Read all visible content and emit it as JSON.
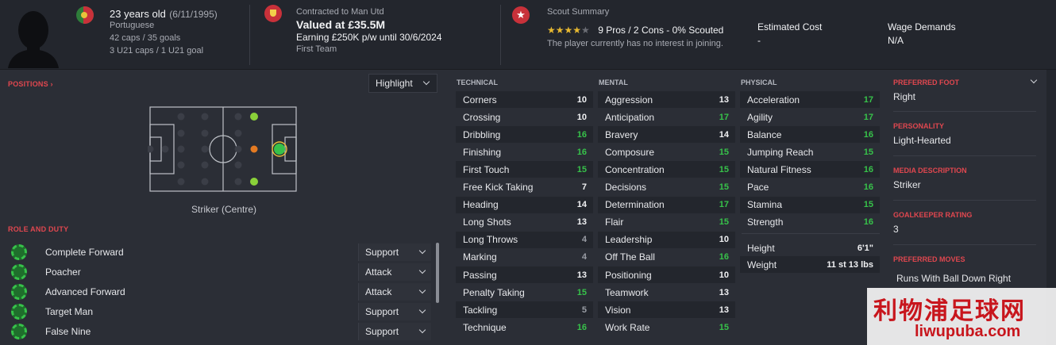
{
  "header": {
    "age": "23 years old",
    "dob": "(6/11/1995)",
    "nationality": "Portuguese",
    "caps": "42 caps / 35 goals",
    "u21_caps": "3 U21 caps / 1 U21 goal",
    "contract_label": "Contracted to Man Utd",
    "value": "Valued at £35.5M",
    "earning": "Earning £250K p/w until 30/6/2024",
    "squad": "First Team",
    "scout_title": "Scout Summary",
    "scout_stars": "★★★★",
    "scout_half": "★",
    "scout_summary": "9 Pros / 2 Cons - 0% Scouted",
    "interest": "The player currently has no interest in joining.",
    "est_cost_label": "Estimated Cost",
    "est_cost_value": "-",
    "wage_label": "Wage Demands",
    "wage_value": "N/A"
  },
  "positions": {
    "label": "POSITIONS",
    "arrow": "›",
    "highlight": "Highlight",
    "position_name": "Striker (Centre)"
  },
  "roles": {
    "label": "ROLE AND DUTY",
    "items": [
      {
        "name": "Complete Forward",
        "duty": "Support"
      },
      {
        "name": "Poacher",
        "duty": "Attack"
      },
      {
        "name": "Advanced Forward",
        "duty": "Attack"
      },
      {
        "name": "Target Man",
        "duty": "Support"
      },
      {
        "name": "False Nine",
        "duty": "Support"
      }
    ]
  },
  "technical": {
    "label": "TECHNICAL",
    "items": [
      {
        "name": "Corners",
        "value": "10"
      },
      {
        "name": "Crossing",
        "value": "10"
      },
      {
        "name": "Dribbling",
        "value": "16"
      },
      {
        "name": "Finishing",
        "value": "16"
      },
      {
        "name": "First Touch",
        "value": "15"
      },
      {
        "name": "Free Kick Taking",
        "value": "7"
      },
      {
        "name": "Heading",
        "value": "14"
      },
      {
        "name": "Long Shots",
        "value": "13"
      },
      {
        "name": "Long Throws",
        "value": "4"
      },
      {
        "name": "Marking",
        "value": "4"
      },
      {
        "name": "Passing",
        "value": "13"
      },
      {
        "name": "Penalty Taking",
        "value": "15"
      },
      {
        "name": "Tackling",
        "value": "5"
      },
      {
        "name": "Technique",
        "value": "16"
      }
    ]
  },
  "mental": {
    "label": "MENTAL",
    "items": [
      {
        "name": "Aggression",
        "value": "13"
      },
      {
        "name": "Anticipation",
        "value": "17"
      },
      {
        "name": "Bravery",
        "value": "14"
      },
      {
        "name": "Composure",
        "value": "15"
      },
      {
        "name": "Concentration",
        "value": "15"
      },
      {
        "name": "Decisions",
        "value": "15"
      },
      {
        "name": "Determination",
        "value": "17"
      },
      {
        "name": "Flair",
        "value": "15"
      },
      {
        "name": "Leadership",
        "value": "10"
      },
      {
        "name": "Off The Ball",
        "value": "16"
      },
      {
        "name": "Positioning",
        "value": "10"
      },
      {
        "name": "Teamwork",
        "value": "13"
      },
      {
        "name": "Vision",
        "value": "13"
      },
      {
        "name": "Work Rate",
        "value": "15"
      }
    ]
  },
  "physical": {
    "label": "PHYSICAL",
    "items": [
      {
        "name": "Acceleration",
        "value": "17"
      },
      {
        "name": "Agility",
        "value": "17"
      },
      {
        "name": "Balance",
        "value": "16"
      },
      {
        "name": "Jumping Reach",
        "value": "15"
      },
      {
        "name": "Natural Fitness",
        "value": "16"
      },
      {
        "name": "Pace",
        "value": "16"
      },
      {
        "name": "Stamina",
        "value": "15"
      },
      {
        "name": "Strength",
        "value": "16"
      }
    ],
    "height_label": "Height",
    "height_value": "6'1\"",
    "weight_label": "Weight",
    "weight_value": "11 st 13 lbs"
  },
  "info": {
    "foot_label": "PREFERRED FOOT",
    "foot_value": "Right",
    "personality_label": "PERSONALITY",
    "personality_value": "Light-Hearted",
    "media_label": "MEDIA DESCRIPTION",
    "media_value": "Striker",
    "gk_label": "GOALKEEPER RATING",
    "gk_value": "3",
    "moves_label": "PREFERRED MOVES",
    "moves_value": "Runs With Ball Down Right"
  },
  "watermark": {
    "cn": "利物浦足球网",
    "en": "liwupuba.com"
  },
  "colors": {
    "accent_red": "#e0474f",
    "value_green": "#37c24a",
    "value_grey": "#9a9da5",
    "value_white": "#f0f1f3"
  }
}
